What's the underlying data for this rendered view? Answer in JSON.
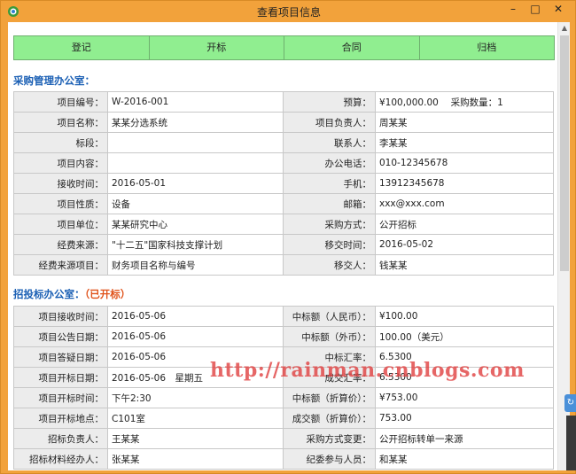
{
  "window": {
    "title": "查看项目信息",
    "minimize_label": "–",
    "maximize_label": "□",
    "close_label": "✕"
  },
  "tabs": [
    "登记",
    "开标",
    "合同",
    "归档"
  ],
  "procurement": {
    "title": "采购管理办公室：",
    "rows": [
      [
        "项目编号：",
        "W-2016-001",
        "预算：",
        "¥100,000.00　 采购数量：1"
      ],
      [
        "项目名称：",
        "某某分选系统",
        "项目负责人：",
        "周某某"
      ],
      [
        "标段：",
        "",
        "联系人：",
        "李某某"
      ],
      [
        "项目内容：",
        "",
        "办公电话：",
        "010-12345678"
      ],
      [
        "接收时间：",
        "2016-05-01",
        "手机：",
        "13912345678"
      ],
      [
        "项目性质：",
        "设备",
        "邮箱：",
        "xxx@xxx.com"
      ],
      [
        "项目单位：",
        "某某研究中心",
        "采购方式：",
        "公开招标"
      ],
      [
        "经费来源：",
        "\"十二五\"国家科技支撑计划",
        "移交时间：",
        "2016-05-02"
      ],
      [
        "经费来源项目：",
        "财务项目名称与编号",
        "移交人：",
        "钱某某"
      ]
    ]
  },
  "bidding": {
    "title": "招投标办公室：",
    "status": "（已开标）",
    "rows": [
      [
        "项目接收时间：",
        "2016-05-06",
        "中标额（人民币）：",
        "¥100.00"
      ],
      [
        "项目公告日期：",
        "2016-05-06",
        "中标额（外币）：",
        "100.00（美元）"
      ],
      [
        "项目答疑日期：",
        "2016-05-06",
        "中标汇率：",
        "6.5300"
      ],
      [
        "项目开标日期：",
        "2016-05-06　星期五",
        "成交汇率：",
        "6.5300"
      ],
      [
        "项目开标时间：",
        "下午2:30",
        "中标额（折算价）：",
        "¥753.00"
      ],
      [
        "项目开标地点：",
        "C101室",
        "成交额（折算价）：",
        "753.00"
      ],
      [
        "招标负责人：",
        "王某某",
        "采购方式变更：",
        "公开招标转单一来源"
      ],
      [
        "招标材料经办人：",
        "张某某",
        "纪委参与人员：",
        "和某某"
      ]
    ]
  },
  "watermark": "http://rainman.cnblogs.com",
  "side_widget_icon": "refresh-icon",
  "colors": {
    "window_frame": "#f2a23b",
    "tab_bg": "#90ee90",
    "section_title": "#1a5fb4",
    "status_tag": "#e0521a",
    "watermark": "#e04040"
  }
}
